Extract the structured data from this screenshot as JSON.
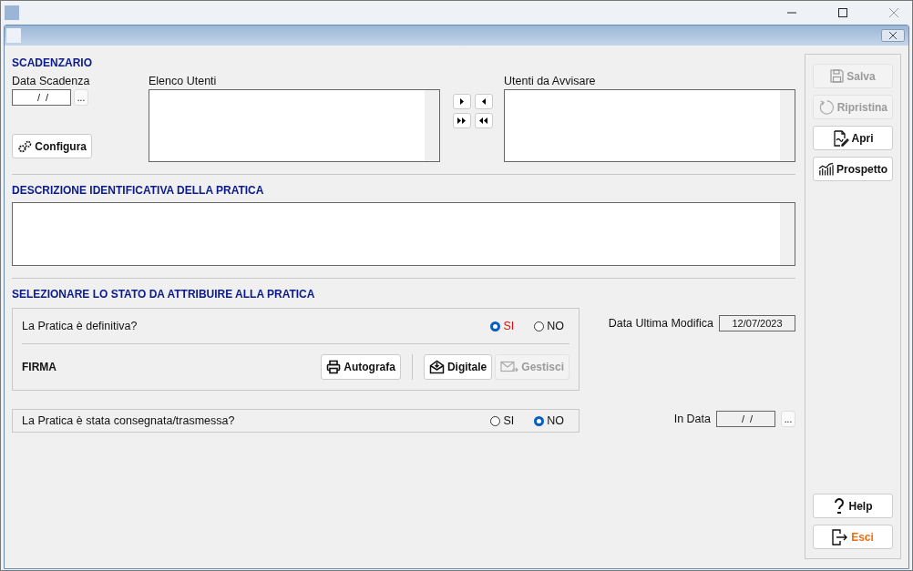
{
  "scadenzario": {
    "heading": "SCADENZARIO",
    "date_label": "Data Scadenza",
    "date_value": " /  /",
    "picker": "...",
    "configure_button": "Configura"
  },
  "lists": {
    "users_label": "Elenco Utenti",
    "notify_label": "Utenti da Avvisare"
  },
  "description": {
    "heading": "DESCRIZIONE IDENTIFICATIVA DELLA PRATICA"
  },
  "state": {
    "heading": "SELEZIONARE LO STATO DA ATTRIBUIRE ALLA PRATICA",
    "definitive": {
      "question": "La Pratica è definitiva?",
      "options": [
        {
          "label": "SI",
          "selected": true,
          "highlight": true
        },
        {
          "label": "NO",
          "selected": false,
          "highlight": false
        }
      ]
    },
    "signature": {
      "label": "FIRMA",
      "buttons": [
        {
          "label": "Autografa",
          "kind": "print",
          "disabled": false
        },
        {
          "label": "Digitale",
          "kind": "envelope",
          "disabled": false
        },
        {
          "label": "Gestisci",
          "kind": "mail",
          "disabled": true
        }
      ]
    },
    "last_modified": {
      "label": "Data Ultima Modifica",
      "value": "12/07/2023"
    },
    "delivered": {
      "question": "La Pratica è stata consegnata/trasmessa?",
      "options": [
        {
          "label": "SI",
          "selected": false,
          "highlight": false
        },
        {
          "label": "NO",
          "selected": true,
          "highlight": false
        }
      ]
    },
    "in_date": {
      "label": "In Data",
      "value": " /  /",
      "picker": "..."
    }
  },
  "side_buttons": [
    {
      "label": "Salva",
      "kind": "save",
      "disabled": true
    },
    {
      "label": "Ripristina",
      "kind": "restore",
      "disabled": true
    },
    {
      "label": "Apri",
      "kind": "open",
      "disabled": false
    },
    {
      "label": "Prospetto",
      "kind": "report",
      "disabled": false
    }
  ],
  "bottom_buttons": [
    {
      "label": "Help",
      "kind": "help",
      "disabled": false
    },
    {
      "label": "Esci",
      "kind": "exit",
      "disabled": false
    }
  ]
}
